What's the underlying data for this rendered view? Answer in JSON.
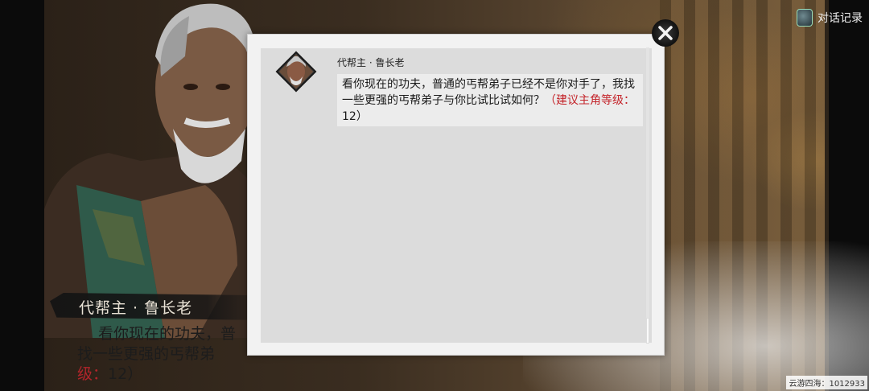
{
  "header": {
    "history_label": "对话记录",
    "history_icon": "book-icon"
  },
  "dialogue": {
    "speaker_name": "代帮主 · 鲁长老",
    "visible_line1": "看你现在的功夫，普",
    "visible_line2": "找一些更强的丐帮弟",
    "visible_line3_red": "级：",
    "visible_line3_rest": "12）"
  },
  "log": {
    "entries": [
      {
        "speaker": "代帮主 · 鲁长老",
        "text": "看你现在的功夫，普通的丐帮弟子已经不是你对手了，我找一些更强的丐帮弟子与你比试比试如何？",
        "hint_open": "（建议主角等级：",
        "hint_level": "12",
        "hint_close": "）"
      }
    ],
    "close_icon": "close-icon"
  },
  "watermark": "云游四海：1012933",
  "colors": {
    "panel_bg": "#f2f2f2",
    "inner_bg": "#dcdcdc",
    "hint_red": "#c4252b"
  }
}
